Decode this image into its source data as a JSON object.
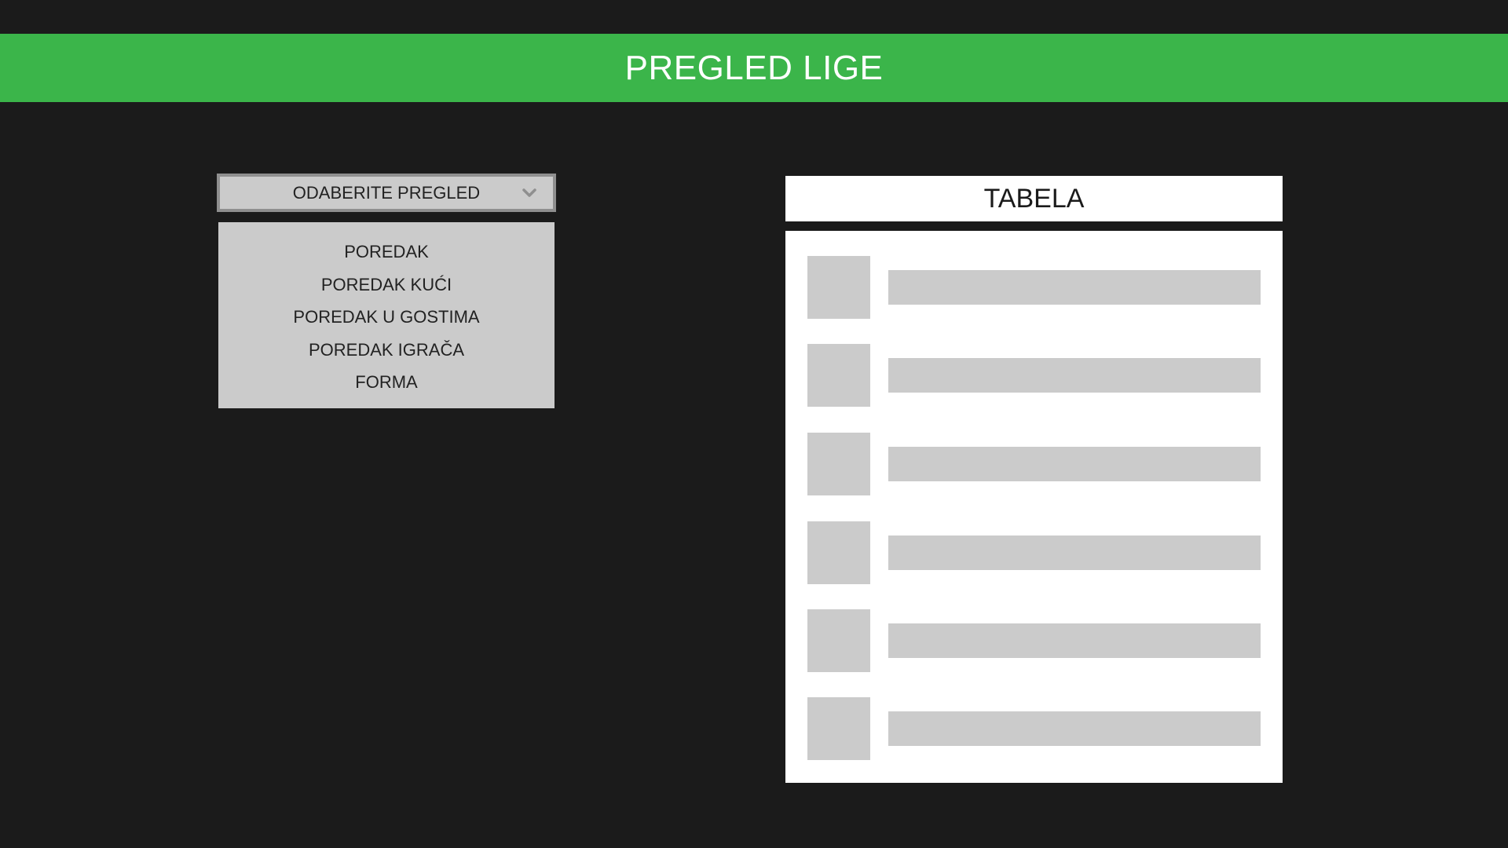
{
  "header": {
    "title": "PREGLED LIGE"
  },
  "view_select": {
    "selected_label": "ODABERITE PREGLED",
    "options": [
      "POREDAK",
      "POREDAK KUĆI",
      "POREDAK U GOSTIMA",
      "POREDAK IGRAČA",
      "FORMA"
    ]
  },
  "table": {
    "title": "TABELA",
    "placeholder_rows": 6
  },
  "icons": {
    "select_toggle": "chevron-down-icon"
  },
  "colors": {
    "background": "#1b1b1b",
    "accent": "#3bb54a",
    "panel": "#ffffff",
    "placeholder": "#cbcbcb",
    "select_border": "#8f8f8f",
    "chevron": "#8f8f8f"
  }
}
